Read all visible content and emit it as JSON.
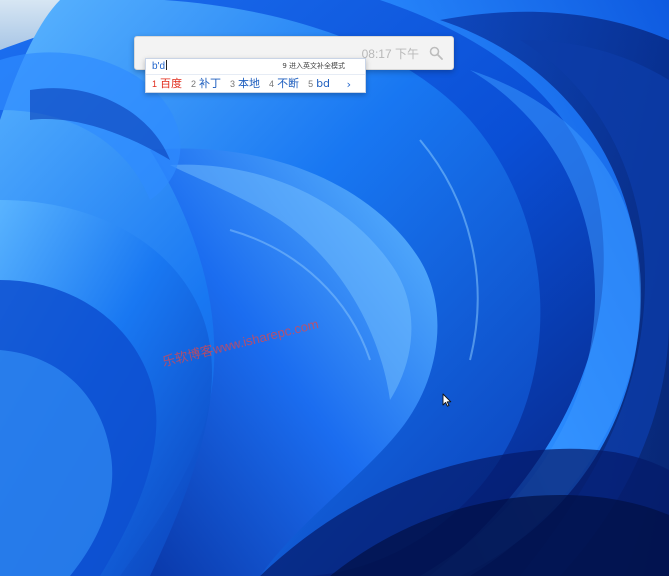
{
  "desktop": {
    "wallpaper": "Windows 11 Bloom wallpaper",
    "colors": {
      "deep": "#0a2a8f",
      "mid": "#0c5ee8",
      "light": "#3fa0ff",
      "sky": "#c9dff3"
    }
  },
  "search_bar": {
    "time_text": "08:17 下午",
    "icon": "search-icon"
  },
  "ime": {
    "composition": "b'd",
    "hint": "9 进入英文补全模式",
    "candidates": [
      {
        "num": "1",
        "text": "百度"
      },
      {
        "num": "2",
        "text": "补丁"
      },
      {
        "num": "3",
        "text": "本地"
      },
      {
        "num": "4",
        "text": "不断"
      },
      {
        "num": "5",
        "text": "bd"
      }
    ],
    "next_icon": "chevron-right-icon",
    "next_glyph": "›",
    "active_color": "#e02a1a",
    "candidate_color": "#1f5fbf"
  },
  "watermark": {
    "text": "乐软博客www.isharepc.com"
  },
  "pointer": {
    "icon": "mouse-pointer-icon"
  }
}
